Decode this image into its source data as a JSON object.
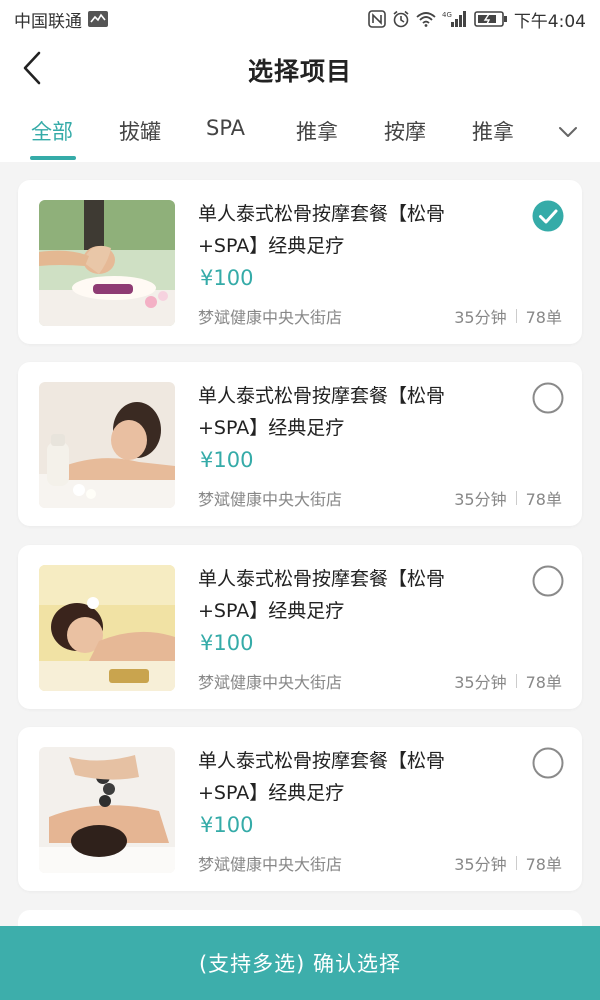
{
  "status_bar": {
    "carrier": "中国联通",
    "time": "下午4:04",
    "network": "4G"
  },
  "header": {
    "title": "选择项目"
  },
  "tabs": [
    {
      "label": "全部",
      "active": true
    },
    {
      "label": "拔罐",
      "active": false
    },
    {
      "label": "SPA",
      "active": false
    },
    {
      "label": "推拿",
      "active": false
    },
    {
      "label": "按摩",
      "active": false
    },
    {
      "label": "推拿",
      "active": false
    }
  ],
  "items": [
    {
      "title": "单人泰式松骨按摩套餐【松骨+SPA】经典足疗",
      "price": "¥100",
      "store": "梦斌健康中央大街店",
      "duration": "35分钟",
      "orders": "78单",
      "selected": true
    },
    {
      "title": "单人泰式松骨按摩套餐【松骨+SPA】经典足疗",
      "price": "¥100",
      "store": "梦斌健康中央大街店",
      "duration": "35分钟",
      "orders": "78单",
      "selected": false
    },
    {
      "title": "单人泰式松骨按摩套餐【松骨+SPA】经典足疗",
      "price": "¥100",
      "store": "梦斌健康中央大街店",
      "duration": "35分钟",
      "orders": "78单",
      "selected": false
    },
    {
      "title": "单人泰式松骨按摩套餐【松骨+SPA】经典足疗",
      "price": "¥100",
      "store": "梦斌健康中央大街店",
      "duration": "35分钟",
      "orders": "78单",
      "selected": false
    }
  ],
  "confirm_button": {
    "label": "(支持多选) 确认选择"
  },
  "colors": {
    "accent": "#35aba8",
    "bottom_bar": "#3daeab"
  }
}
